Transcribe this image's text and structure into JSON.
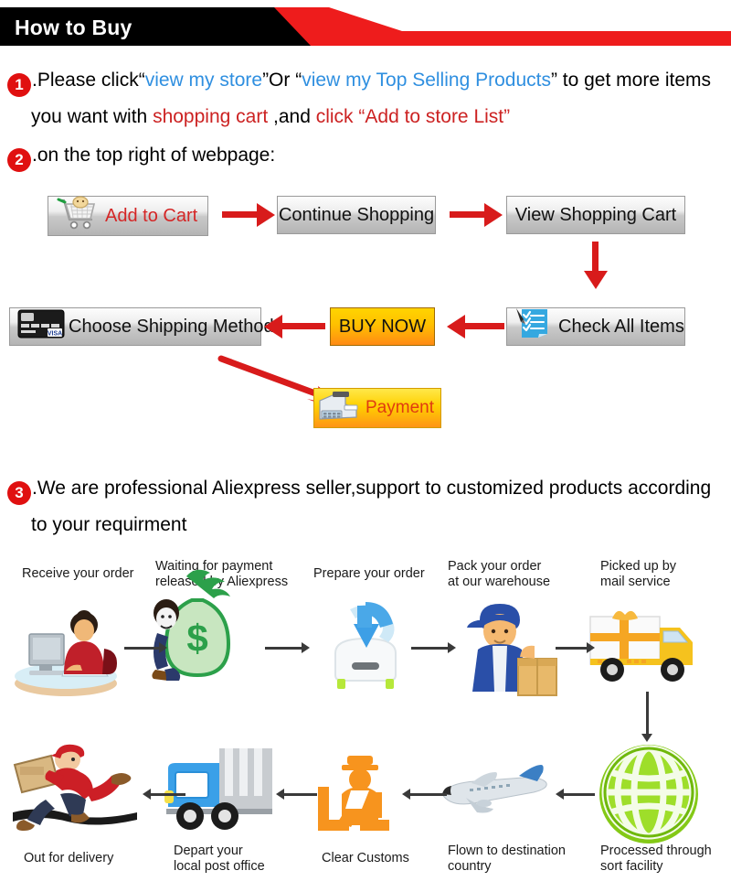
{
  "header": {
    "title": "How to Buy",
    "black_color": "#000000",
    "red_color": "#ee1c1c"
  },
  "steps": [
    {
      "number": "1",
      "line1_a": ".Please click“",
      "link1": "view my store",
      "line1_b": "”Or “",
      "link2": "view my Top Selling Products",
      "line1_c": "” to get more items",
      "line2_a": "you want with ",
      "em1": "shopping cart",
      "line2_b": " ,and ",
      "em2": "click “Add to store List”"
    },
    {
      "number": "2",
      "line1_a": ".on the top right of webpage:"
    },
    {
      "number": "3",
      "line1_a": ".We are professional Aliexpress seller,support to customized products according",
      "line2_a": "to your requirment"
    }
  ],
  "buttons": {
    "add_to_cart": "Add to Cart",
    "continue_shopping": "Continue Shopping",
    "view_shopping_cart": "View Shopping Cart",
    "choose_shipping_method": "Choose Shipping Method",
    "buy_now": "BUY NOW",
    "check_all_items": "Check All Items",
    "payment": "Payment"
  },
  "colors": {
    "arrow_red": "#d81b1b",
    "link_blue": "#2f8fe0",
    "emphasis_red": "#cc2222",
    "badge_red": "#e01010",
    "buy_now_orange": "#ffc000",
    "arrow_gray": "#3a3a3a"
  },
  "process_flow": {
    "row1": [
      {
        "label": "Receive your order",
        "icon": "person-at-computer-icon"
      },
      {
        "label": "Waiting for payment\nreleased by Aliexpress",
        "icon": "money-bag-icon"
      },
      {
        "label": "Prepare your order",
        "icon": "download-box-icon"
      },
      {
        "label": "Pack your order\nat our warehouse",
        "icon": "worker-packing-icon"
      },
      {
        "label": "Picked up by\nmail service",
        "icon": "delivery-truck-gift-icon"
      }
    ],
    "row2": [
      {
        "label": "Out for delivery",
        "icon": "running-courier-icon"
      },
      {
        "label": "Depart your\nlocal post office",
        "icon": "blue-post-truck-icon"
      },
      {
        "label": "Clear Customs",
        "icon": "customs-officer-icon"
      },
      {
        "label": "Flown to destination\ncountry",
        "icon": "airplane-icon"
      },
      {
        "label": "Processed through\nsort facility",
        "icon": "green-globe-icon"
      }
    ]
  }
}
